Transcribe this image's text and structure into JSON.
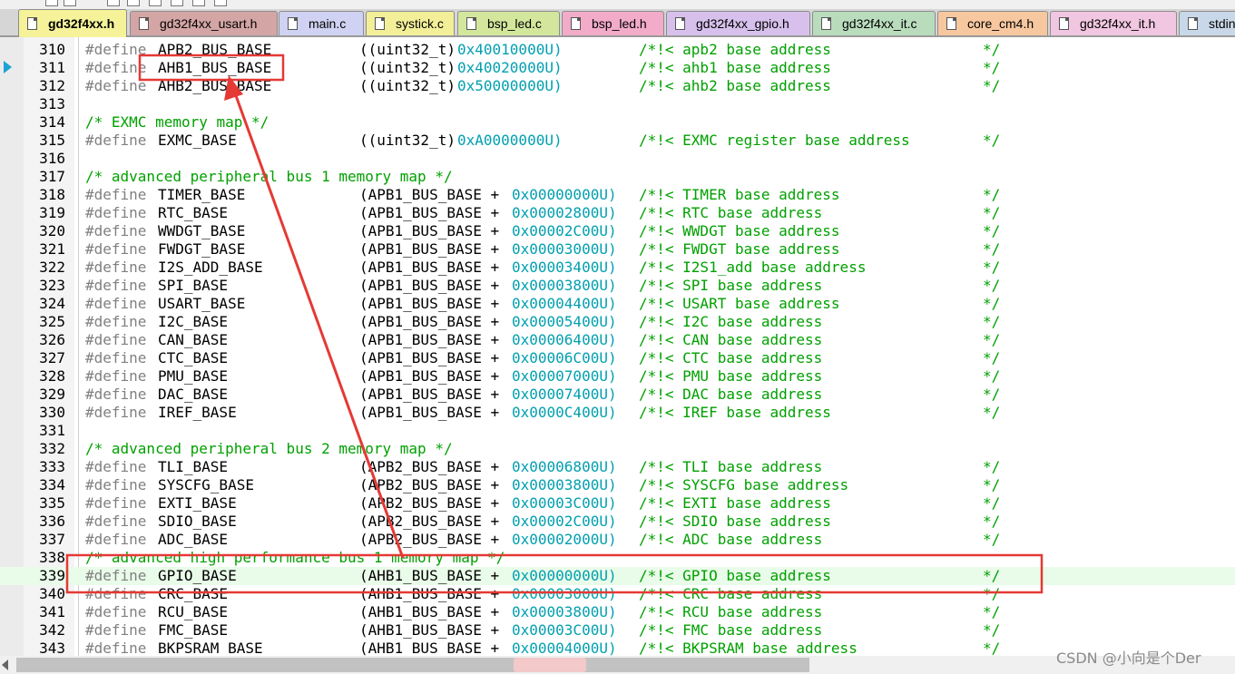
{
  "tabs": [
    {
      "label": "gd32f4xx.h",
      "color": "#f5f29a",
      "active": true
    },
    {
      "label": "gd32f4xx_usart.h",
      "color": "#d4a5a5",
      "active": false
    },
    {
      "label": "main.c",
      "color": "#cfd2f2",
      "active": false
    },
    {
      "label": "systick.c",
      "color": "#f3ef99",
      "active": false
    },
    {
      "label": "bsp_led.c",
      "color": "#d3e79c",
      "active": false
    },
    {
      "label": "bsp_led.h",
      "color": "#f2abc9",
      "active": false
    },
    {
      "label": "gd32f4xx_gpio.h",
      "color": "#d7c1ec",
      "active": false
    },
    {
      "label": "gd32f4xx_it.c",
      "color": "#b9dcbd",
      "active": false
    },
    {
      "label": "core_cm4.h",
      "color": "#f7c7a0",
      "active": false
    },
    {
      "label": "gd32f4xx_it.h",
      "color": "#f1c6e0",
      "active": false
    },
    {
      "label": "stdint",
      "color": "#c9d8e8",
      "active": false
    }
  ],
  "colors": {
    "keyword": "#808080",
    "number": "#009faf",
    "comment": "#00a000",
    "annotation": "#e53935",
    "current_line": "#e9fbe9"
  },
  "current_line": 339,
  "lines": [
    {
      "n": "310",
      "def": "APB2_BUS_BASE",
      "val": "((uint32_t)",
      "hex": "0x40010000U)",
      "cmt": "/*!< apb2 base address",
      "end": "*/"
    },
    {
      "n": "311",
      "def": "AHB1_BUS_BASE",
      "val": "((uint32_t)",
      "hex": "0x40020000U)",
      "cmt": "/*!< ahb1 base address",
      "end": "*/"
    },
    {
      "n": "312",
      "def": "AHB2_BUS_BASE",
      "val": "((uint32_t)",
      "hex": "0x50000000U)",
      "cmt": "/*!< ahb2 base address",
      "end": "*/"
    },
    {
      "n": "313"
    },
    {
      "n": "314",
      "comment": "/* EXMC memory map */"
    },
    {
      "n": "315",
      "def": "EXMC_BASE",
      "val": "((uint32_t)",
      "hex": "0xA0000000U)",
      "cmt": "/*!< EXMC register base address",
      "end": "*/"
    },
    {
      "n": "316"
    },
    {
      "n": "317",
      "comment": "/* advanced peripheral bus 1 memory map */"
    },
    {
      "n": "318",
      "def": "TIMER_BASE",
      "val": "(APB1_BUS_BASE + ",
      "hex": "0x00000000U)",
      "cmt": "/*!< TIMER base address",
      "end": "*/"
    },
    {
      "n": "319",
      "def": "RTC_BASE",
      "val": "(APB1_BUS_BASE + ",
      "hex": "0x00002800U)",
      "cmt": "/*!< RTC base address",
      "end": "*/"
    },
    {
      "n": "320",
      "def": "WWDGT_BASE",
      "val": "(APB1_BUS_BASE + ",
      "hex": "0x00002C00U)",
      "cmt": "/*!< WWDGT base address",
      "end": "*/"
    },
    {
      "n": "321",
      "def": "FWDGT_BASE",
      "val": "(APB1_BUS_BASE + ",
      "hex": "0x00003000U)",
      "cmt": "/*!< FWDGT base address",
      "end": "*/"
    },
    {
      "n": "322",
      "def": "I2S_ADD_BASE",
      "val": "(APB1_BUS_BASE + ",
      "hex": "0x00003400U)",
      "cmt": "/*!< I2S1_add base address",
      "end": "*/"
    },
    {
      "n": "323",
      "def": "SPI_BASE",
      "val": "(APB1_BUS_BASE + ",
      "hex": "0x00003800U)",
      "cmt": "/*!< SPI base address",
      "end": "*/"
    },
    {
      "n": "324",
      "def": "USART_BASE",
      "val": "(APB1_BUS_BASE + ",
      "hex": "0x00004400U)",
      "cmt": "/*!< USART base address",
      "end": "*/"
    },
    {
      "n": "325",
      "def": "I2C_BASE",
      "val": "(APB1_BUS_BASE + ",
      "hex": "0x00005400U)",
      "cmt": "/*!< I2C base address",
      "end": "*/"
    },
    {
      "n": "326",
      "def": "CAN_BASE",
      "val": "(APB1_BUS_BASE + ",
      "hex": "0x00006400U)",
      "cmt": "/*!< CAN base address",
      "end": "*/"
    },
    {
      "n": "327",
      "def": "CTC_BASE",
      "val": "(APB1_BUS_BASE + ",
      "hex": "0x00006C00U)",
      "cmt": "/*!< CTC base address",
      "end": "*/"
    },
    {
      "n": "328",
      "def": "PMU_BASE",
      "val": "(APB1_BUS_BASE + ",
      "hex": "0x00007000U)",
      "cmt": "/*!< PMU base address",
      "end": "*/"
    },
    {
      "n": "329",
      "def": "DAC_BASE",
      "val": "(APB1_BUS_BASE + ",
      "hex": "0x00007400U)",
      "cmt": "/*!< DAC base address",
      "end": "*/"
    },
    {
      "n": "330",
      "def": "IREF_BASE",
      "val": "(APB1_BUS_BASE + ",
      "hex": "0x0000C400U)",
      "cmt": "/*!< IREF base address",
      "end": "*/"
    },
    {
      "n": "331"
    },
    {
      "n": "332",
      "comment": "/* advanced peripheral bus 2 memory map */"
    },
    {
      "n": "333",
      "def": "TLI_BASE",
      "val": "(APB2_BUS_BASE + ",
      "hex": "0x00006800U)",
      "cmt": "/*!< TLI base address",
      "end": "*/"
    },
    {
      "n": "334",
      "def": "SYSCFG_BASE",
      "val": "(APB2_BUS_BASE + ",
      "hex": "0x00003800U)",
      "cmt": "/*!< SYSCFG base address",
      "end": "*/"
    },
    {
      "n": "335",
      "def": "EXTI_BASE",
      "val": "(APB2_BUS_BASE + ",
      "hex": "0x00003C00U)",
      "cmt": "/*!< EXTI base address",
      "end": "*/"
    },
    {
      "n": "336",
      "def": "SDIO_BASE",
      "val": "(APB2_BUS_BASE + ",
      "hex": "0x00002C00U)",
      "cmt": "/*!< SDIO base address",
      "end": "*/"
    },
    {
      "n": "337",
      "def": "ADC_BASE",
      "val": "(APB2_BUS_BASE + ",
      "hex": "0x00002000U)",
      "cmt": "/*!< ADC base address",
      "end": "*/"
    },
    {
      "n": "338",
      "comment": "/* advanced high performance bus 1 memory map */"
    },
    {
      "n": "339",
      "def": "GPIO_BASE",
      "val": "(AHB1_BUS_BASE + ",
      "hex": "0x00000000U)",
      "cmt": "/*!< GPIO base address",
      "end": "*/"
    },
    {
      "n": "340",
      "def": "CRC_BASE",
      "val": "(AHB1_BUS_BASE + ",
      "hex": "0x00003000U)",
      "cmt": "/*!< CRC base address",
      "end": "*/"
    },
    {
      "n": "341",
      "def": "RCU_BASE",
      "val": "(AHB1_BUS_BASE + ",
      "hex": "0x00003800U)",
      "cmt": "/*!< RCU base address",
      "end": "*/"
    },
    {
      "n": "342",
      "def": "FMC_BASE",
      "val": "(AHB1_BUS_BASE + ",
      "hex": "0x00003C00U)",
      "cmt": "/*!< FMC base address",
      "end": "*/"
    },
    {
      "n": "343",
      "def": "BKPSRAM_BASE",
      "val": "(AHB1_BUS_BASE + ",
      "hex": "0x00004000U)",
      "cmt": "/*!< BKPSRAM base address",
      "end": "*/"
    }
  ],
  "define_keyword": "#define",
  "watermark": "CSDN @小向是个Der"
}
